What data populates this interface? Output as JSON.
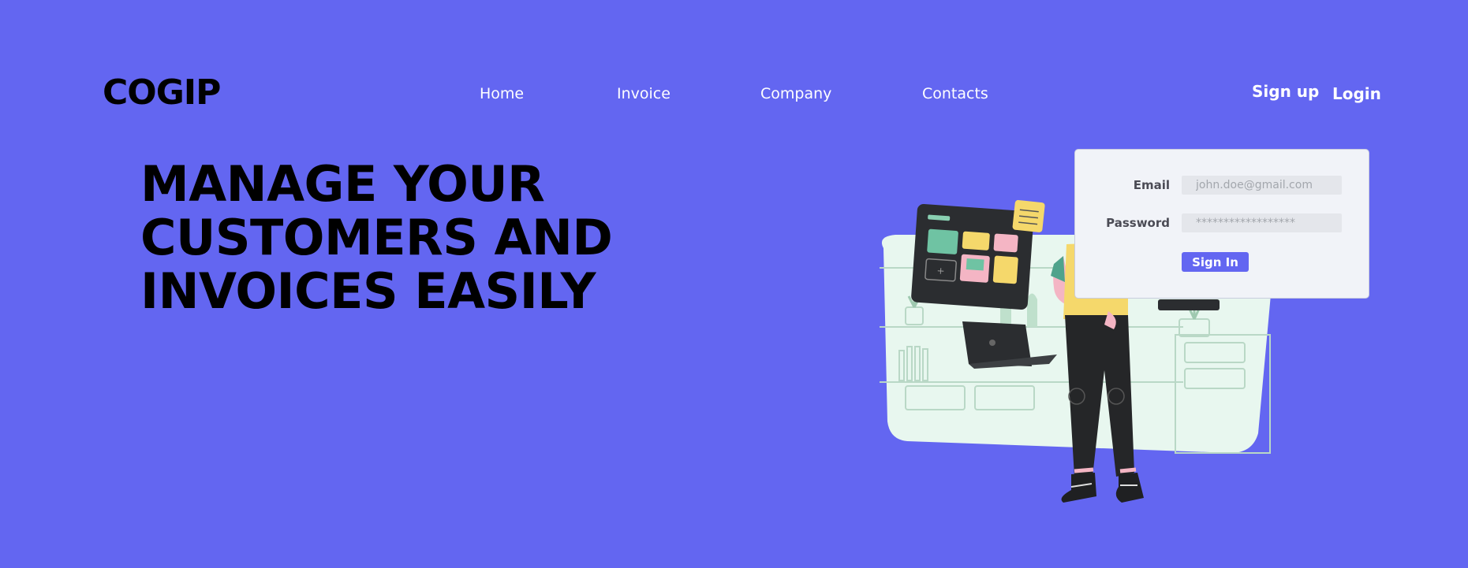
{
  "brand": {
    "logo": "COGIP"
  },
  "nav": {
    "home": "Home",
    "invoice": "Invoice",
    "company": "Company",
    "contacts": "Contacts"
  },
  "auth": {
    "signup": "Sign up",
    "login": "Login"
  },
  "hero": {
    "line1": "MANAGE YOUR",
    "line2": "CUSTOMERS AND",
    "line3": "INVOICES EASILY"
  },
  "login_form": {
    "email_label": "Email",
    "email_placeholder": "john.doe@gmail.com",
    "password_label": "Password",
    "password_placeholder": "******************",
    "submit_label": "Sign In"
  },
  "colors": {
    "background": "#6366f1",
    "accent": "#6366f1",
    "card": "#f1f3f8"
  }
}
